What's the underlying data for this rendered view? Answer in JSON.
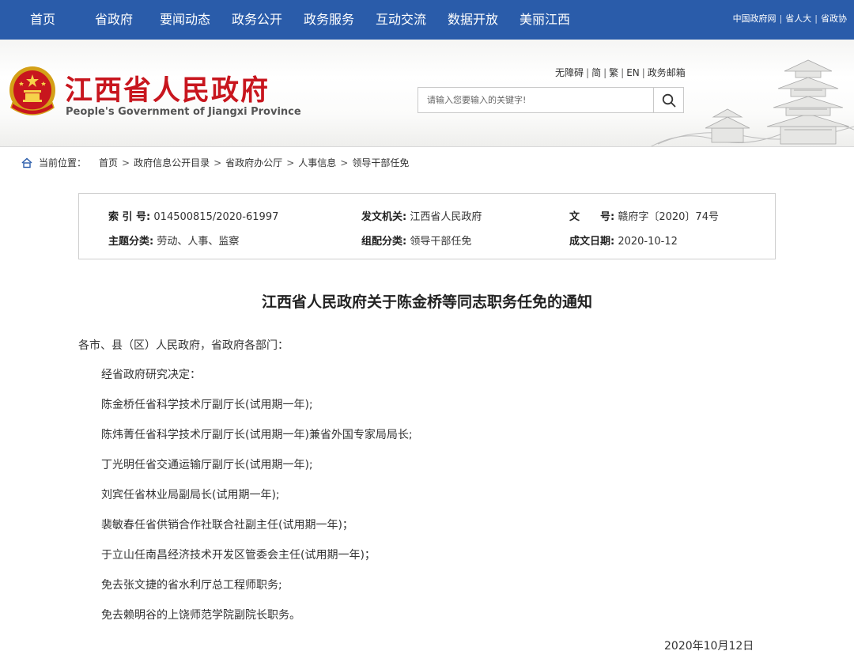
{
  "topnav": {
    "items": [
      "首页",
      "省政府",
      "要闻动态",
      "政务公开",
      "政务服务",
      "互动交流",
      "数据开放",
      "美丽江西"
    ],
    "right_links": [
      "中国政府网",
      "省人大",
      "省政协"
    ]
  },
  "header": {
    "title": "江西省人民政府",
    "subtitle": "People's Government of Jiangxi Province",
    "util_links": [
      "无障碍",
      "简",
      "繁",
      "EN",
      "政务邮箱"
    ],
    "search_placeholder": "请输入您要输入的关键字!"
  },
  "breadcrumb": {
    "label": "当前位置：",
    "items": [
      "首页",
      "政府信息公开目录",
      "省政府办公厅",
      "人事信息",
      "领导干部任免"
    ]
  },
  "info": {
    "index_label": "索 引 号:",
    "index_value": "014500815/2020-61997",
    "issuer_label": "发文机关:",
    "issuer_value": "江西省人民政府",
    "doc_no_label": "文　　号:",
    "doc_no_value": "赣府字〔2020〕74号",
    "topic_label": "主题分类:",
    "topic_value": "劳动、人事、监察",
    "category_label": "组配分类:",
    "category_value": "领导干部任免",
    "date_label": "成文日期:",
    "date_value": "2020-10-12"
  },
  "article": {
    "title": "江西省人民政府关于陈金桥等同志职务任免的通知",
    "salutation": "各市、县（区）人民政府，省政府各部门：",
    "paragraphs": [
      "经省政府研究决定：",
      "陈金桥任省科学技术厅副厅长(试用期一年);",
      "陈炜菁任省科学技术厅副厅长(试用期一年)兼省外国专家局局长;",
      "丁光明任省交通运输厅副厅长(试用期一年);",
      "刘宾任省林业局副局长(试用期一年);",
      "裴敏春任省供销合作社联合社副主任(试用期一年)；",
      "于立山任南昌经济技术开发区管委会主任(试用期一年)；",
      "免去张文捷的省水利厅总工程师职务;",
      "免去赖明谷的上饶师范学院副院长职务。"
    ],
    "date": "2020年10月12日"
  },
  "colors": {
    "nav_bg": "#2a5caa",
    "title_red": "#c8161e"
  }
}
